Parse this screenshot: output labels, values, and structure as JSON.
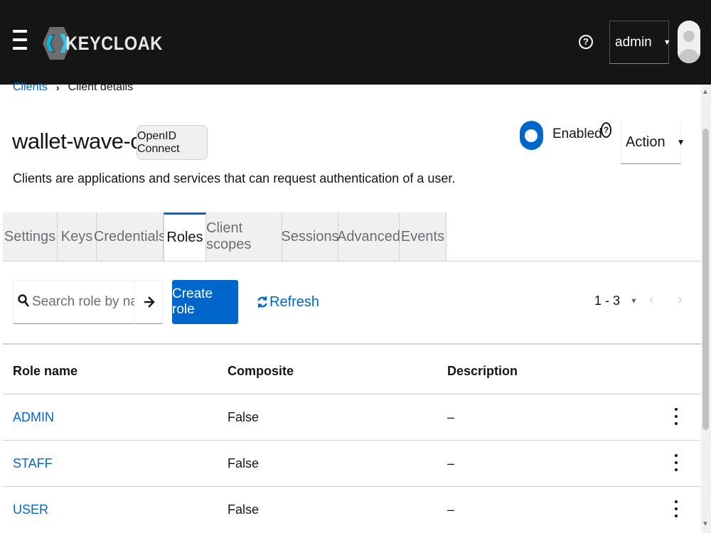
{
  "header": {
    "brand": "KEYCLOAK",
    "user_label": "admin",
    "help_glyph": "?",
    "caret": "▼",
    "icons": [
      "hamburger-icon",
      "keycloak-logo-icon",
      "help-icon",
      "user-avatar-icon"
    ]
  },
  "breadcrumb": {
    "parent": "Clients",
    "separator": "›",
    "current": "Client details"
  },
  "client": {
    "name": "wallet-wave-client",
    "protocol": "OpenID Connect",
    "description": "Clients are applications and services that can request authentication of a user.",
    "enabled_label": "Enabled",
    "enabled": true,
    "help_glyph": "?",
    "action_label": "Action",
    "caret": "▼"
  },
  "tabs": [
    {
      "label": "Settings",
      "active": false
    },
    {
      "label": "Keys",
      "active": false
    },
    {
      "label": "Credentials",
      "active": false
    },
    {
      "label": "Roles",
      "active": true
    },
    {
      "label": "Client scopes",
      "active": false
    },
    {
      "label": "Sessions",
      "active": false
    },
    {
      "label": "Advanced",
      "active": false
    },
    {
      "label": "Events",
      "active": false
    }
  ],
  "toolbar": {
    "search_placeholder": "Search role by name",
    "create_label": "Create role",
    "refresh_label": "Refresh",
    "pagination_label": "1 - 3",
    "caret": "▼",
    "prev_glyph": "‹",
    "next_glyph": "›"
  },
  "table": {
    "columns": [
      "Role name",
      "Composite",
      "Description"
    ],
    "rows": [
      {
        "name": "ADMIN",
        "composite": "False",
        "description": "–"
      },
      {
        "name": "STAFF",
        "composite": "False",
        "description": "–"
      },
      {
        "name": "USER",
        "composite": "False",
        "description": "–"
      }
    ]
  },
  "colors": {
    "header_bg": "#151515",
    "accent": "#0066cc",
    "tab_inactive_bg": "#f0f0f0"
  }
}
